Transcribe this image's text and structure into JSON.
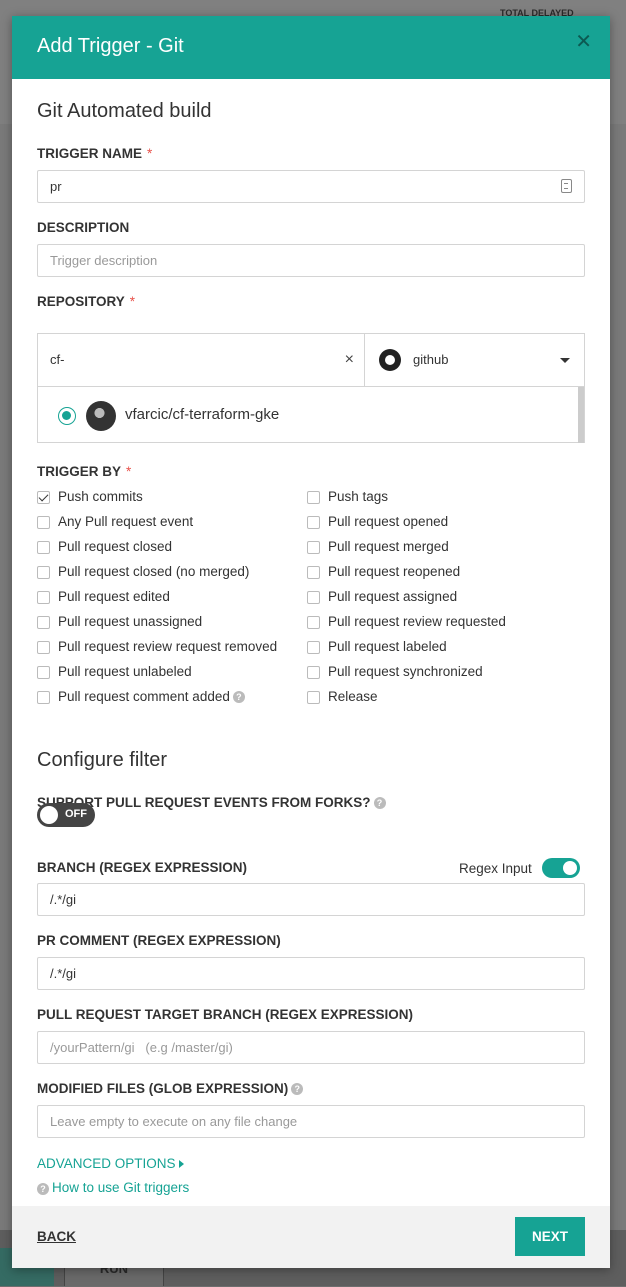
{
  "modal": {
    "title": "Add Trigger - Git",
    "close_icon": "close-icon"
  },
  "form": {
    "heading": "Git Automated build",
    "trigger_name": {
      "label": "TRIGGER NAME",
      "required_mark": "*",
      "value": "pr"
    },
    "description": {
      "label": "DESCRIPTION",
      "placeholder": "Trigger description"
    },
    "repository": {
      "label": "REPOSITORY",
      "required_mark": "*",
      "search_value": "cf-",
      "clear_icon": "×",
      "provider": "github",
      "results": [
        {
          "name": "vfarcic/cf-terraform-gke",
          "selected": true
        }
      ]
    },
    "trigger_by": {
      "label": "TRIGGER BY",
      "required_mark": "*",
      "left": [
        {
          "label": "Push commits",
          "checked": true
        },
        {
          "label": "Any Pull request event",
          "checked": false
        },
        {
          "label": "Pull request closed",
          "checked": false
        },
        {
          "label": "Pull request closed (no merged)",
          "checked": false
        },
        {
          "label": "Pull request edited",
          "checked": false
        },
        {
          "label": "Pull request unassigned",
          "checked": false
        },
        {
          "label": "Pull request review request removed",
          "checked": false
        },
        {
          "label": "Pull request unlabeled",
          "checked": false
        },
        {
          "label": "Pull request comment added",
          "checked": false
        }
      ],
      "right": [
        {
          "label": "Push tags",
          "checked": false
        },
        {
          "label": "Pull request opened",
          "checked": false
        },
        {
          "label": "Pull request merged",
          "checked": false
        },
        {
          "label": "Pull request reopened",
          "checked": false
        },
        {
          "label": "Pull request assigned",
          "checked": false
        },
        {
          "label": "Pull request review requested",
          "checked": false
        },
        {
          "label": "Pull request labeled",
          "checked": false
        },
        {
          "label": "Pull request synchronized",
          "checked": false
        },
        {
          "label": "Release",
          "checked": false
        }
      ]
    },
    "filter": {
      "heading": "Configure filter",
      "forks_label": "SUPPORT PULL REQUEST EVENTS FROM FORKS?",
      "forks_toggle": "OFF",
      "branch_label": "BRANCH (REGEX EXPRESSION)",
      "regex_input_label": "Regex Input",
      "branch_value": "/.*/gi",
      "pr_comment_label": "PR COMMENT (REGEX EXPRESSION)",
      "pr_comment_value": "/.*/gi",
      "pr_target_label": "PULL REQUEST TARGET BRANCH (REGEX EXPRESSION)",
      "pr_target_placeholder": "/yourPattern/gi   (e.g /master/gi)",
      "modified_label": "MODIFIED FILES (GLOB EXPRESSION)",
      "modified_placeholder": "Leave empty to execute on any file change"
    },
    "advanced_options": "ADVANCED OPTIONS",
    "help_link": "How to use Git triggers"
  },
  "footer": {
    "back": "BACK",
    "next": "NEXT"
  },
  "background": {
    "top_right": "TOTAL DELAYED",
    "run": "RUN"
  },
  "colors": {
    "accent": "#16a394",
    "required": "#e8514a"
  }
}
